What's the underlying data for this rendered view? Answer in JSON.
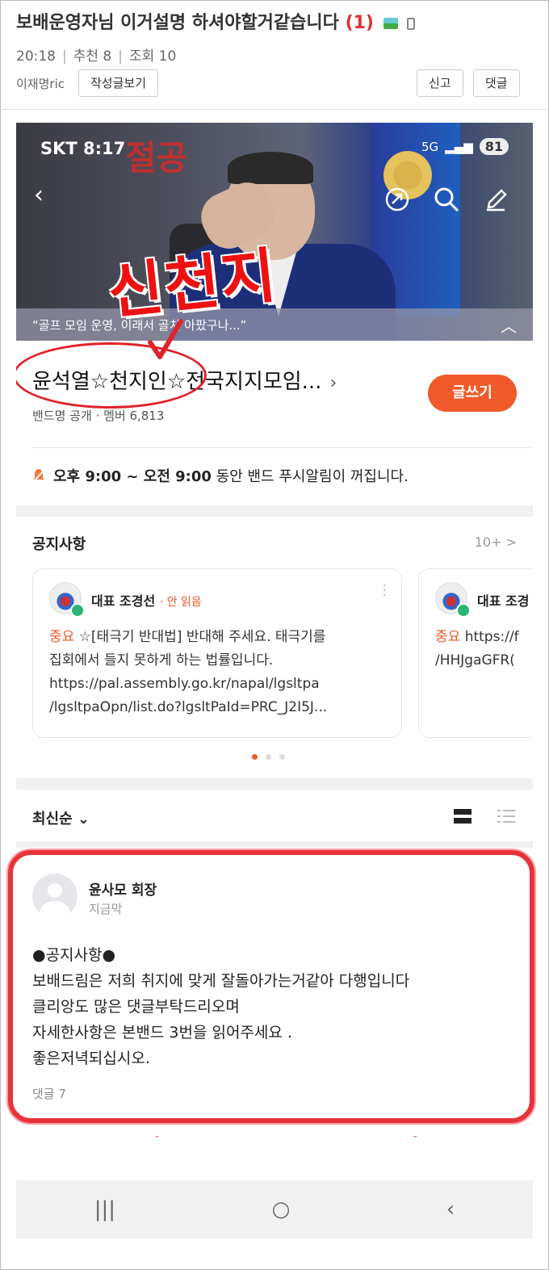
{
  "forum": {
    "title": "보배운영자님 이거설명 하셔야할거같습니다",
    "comment_count": "(1)",
    "time": "20:18",
    "recommend": "추천 8",
    "views": "조회 10",
    "author": "이재명ric",
    "view_posts_btn": "작성글보기",
    "report_btn": "신고",
    "comment_btn": "댓글"
  },
  "screenshot": {
    "status": {
      "carrier_time": "SKT 8:17",
      "network": "5G",
      "battery": "81"
    },
    "banner": {
      "background_text": "절공",
      "caption": "“골프 모임 운영, 이래서 골치 아팠구나...”"
    },
    "stamp_text": "신천지",
    "band": {
      "name": "윤석열☆천지인☆전국지지모임...",
      "sub": "밴드명 공개 · 멤버 6,813",
      "write_btn": "글쓰기"
    },
    "push_notice": {
      "time_range": "오후 9:00 ~ 오전 9:00",
      "rest": " 동안 밴드 푸시알림이 꺼집니다."
    },
    "notices": {
      "title": "공지사항",
      "more": "10+ >",
      "cards": [
        {
          "author": "대표 조경선",
          "status": "· 안 읽음",
          "tag": "중요",
          "lines": [
            "☆[태극기 반대법] 반대해 주세요. 태극기를",
            "집회에서 들지 못하게 하는 법률입니다.",
            "https://pal.assembly.go.kr/napal/lgsltpa",
            "/lgsltpaOpn/list.do?lgsltPaId=PRC_J2I5J..."
          ]
        },
        {
          "author": "대표 조경",
          "tag": "중요",
          "lines": [
            "https://f",
            "/HHJgaGFR("
          ]
        }
      ]
    },
    "sort_label": "최신순 ⌄",
    "post": {
      "author": "윤사모 회장",
      "time": "지금막",
      "lines": [
        "●공지사항●",
        "보배드림은 저희 취지에 맞게 잘돌아가는거같아 다행입니다",
        "클리앙도 많은 댓글부탁드리오며",
        "자세한사항은 본밴드 3번을 읽어주세요 .",
        "좋은저녁되십시오."
      ],
      "comments": "댓글 7"
    },
    "tabs": [
      "chat-icon",
      "photo-icon",
      "calendar-icon",
      "folder-check-icon",
      "members-icon",
      "settings-icon"
    ],
    "nav": [
      "|||",
      "○",
      "‹"
    ]
  },
  "colors": {
    "accent": "#f05a2a",
    "highlight_red": "#e8323a"
  }
}
